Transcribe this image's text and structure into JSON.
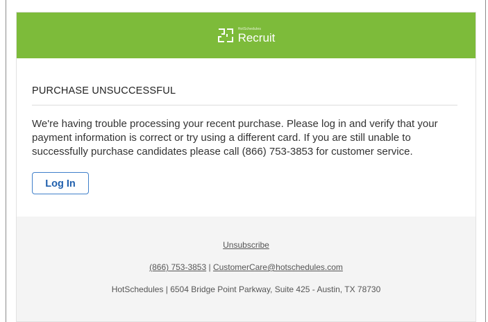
{
  "header": {
    "logo_sup": "HotSchedules",
    "logo_main": "Recruit",
    "accent_color": "#7dbb3a",
    "logo_icon": "hotschedules-logo-icon"
  },
  "content": {
    "heading": "PURCHASE UNSUCCESSFUL",
    "message": "We're having trouble processing your recent purchase. Please log in and verify that your payment information is correct or try using a different card. If you are still unable to successfully purchase candidates please call (866) 753-3853 for customer service.",
    "login_button": "Log In",
    "button_color": "#1f5fad"
  },
  "footer": {
    "unsubscribe": "Unsubscribe",
    "phone": "(866) 753-3853",
    "separator": " | ",
    "email": "CustomerCare@hotschedules.com",
    "address": "HotSchedules | 6504 Bridge Point Parkway, Suite 425 - Austin, TX 78730"
  }
}
